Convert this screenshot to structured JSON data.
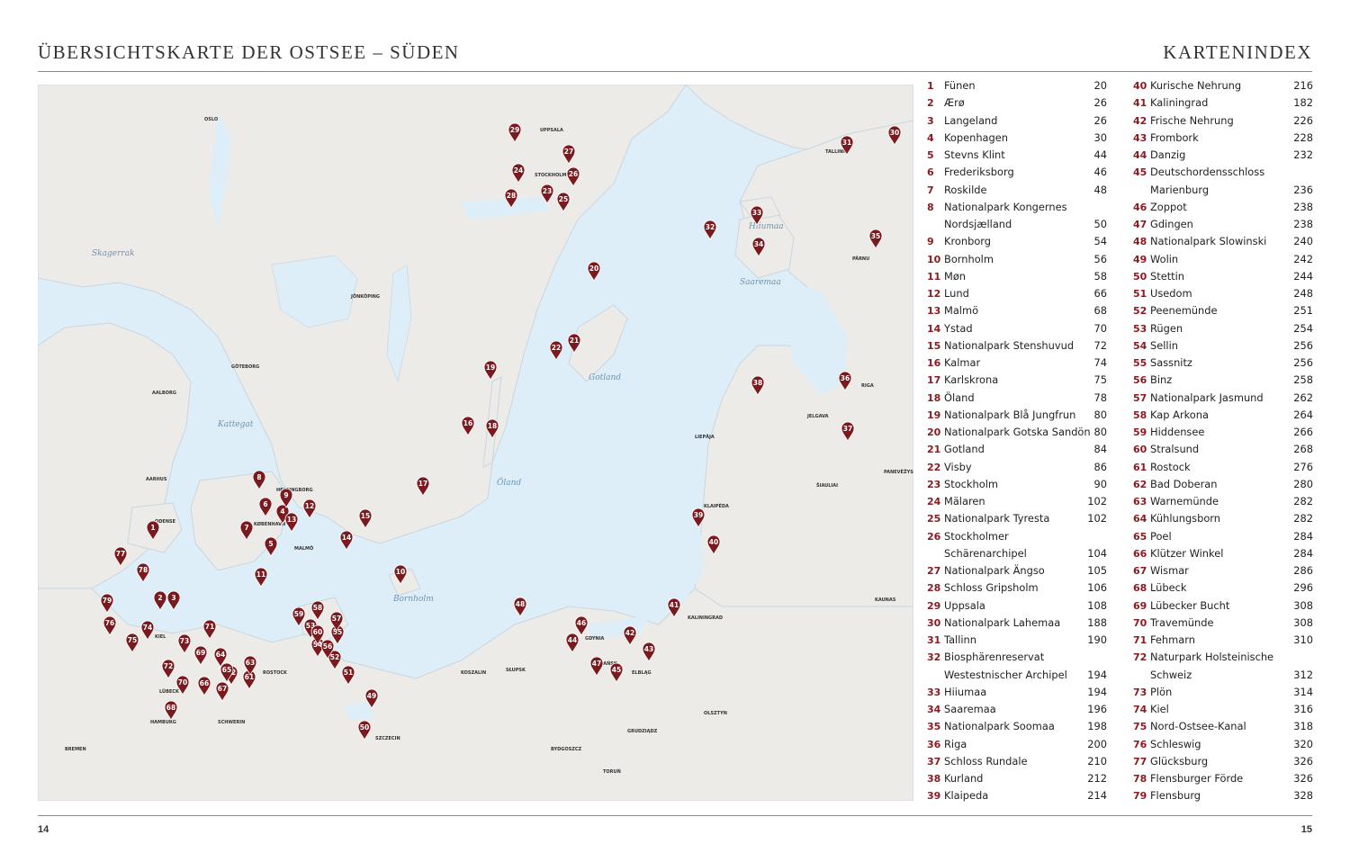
{
  "header": {
    "left_title": "ÜBERSICHTSKARTE DER OSTSEE – SÜDEN",
    "right_title": "KARTENINDEX"
  },
  "footer": {
    "left_page": "14",
    "right_page": "15"
  },
  "colors": {
    "pin": "#7a1a1f",
    "sea": "#ddeef8",
    "land": "#ececea",
    "index_number": "#8a1c22"
  },
  "map": {
    "city_labels": [
      "OSLO",
      "UPPSALA",
      "STOCKHOLM",
      "TALLINN",
      "GÖTEBORG",
      "JÖNKÖPING",
      "AALBORG",
      "AARHUS",
      "HELSINGBORG",
      "KØBENHAVN",
      "MALMÖ",
      "ODENSE",
      "KIEL",
      "LÜBECK",
      "HAMBURG",
      "BREMEN",
      "SCHWERIN",
      "ROSTOCK",
      "SZCZECIN",
      "KOSZALIN",
      "SŁUPSK",
      "GDYNIA",
      "GDAŃSK",
      "ELBLĄG",
      "KALININGRAD",
      "KLAIPĖDA",
      "RIGA",
      "ŠIAULIAI",
      "PANEVĖŽYS",
      "KAUNAS",
      "BYDGOSZCZ",
      "TORUŃ",
      "OLSZTYN",
      "GRUDZIĄDZ",
      "PÄRNU",
      "LIEPĀJA",
      "JELGAVA"
    ],
    "sea_labels": [
      "Kattegat",
      "Skagerrak",
      "Gotland",
      "Öland",
      "Saaremaa",
      "Hiiumaa",
      "Bornholm"
    ],
    "markers": [
      "1",
      "2",
      "3",
      "4",
      "5",
      "6",
      "7",
      "8",
      "9",
      "10",
      "11",
      "12",
      "13",
      "14",
      "15",
      "16",
      "17",
      "18",
      "19",
      "20",
      "21",
      "22",
      "23",
      "24",
      "25",
      "26",
      "27",
      "28",
      "29",
      "30",
      "31",
      "32",
      "33",
      "34",
      "35",
      "36",
      "37",
      "38",
      "39",
      "40",
      "41",
      "42",
      "43",
      "44",
      "45",
      "46",
      "47",
      "48",
      "49",
      "50",
      "51",
      "52",
      "53",
      "54",
      "55",
      "56",
      "57",
      "58",
      "59",
      "60",
      "61",
      "62",
      "63",
      "64",
      "65",
      "66",
      "67",
      "68",
      "69",
      "70",
      "71",
      "72",
      "73",
      "74",
      "75",
      "76",
      "77",
      "78",
      "79"
    ]
  },
  "index": {
    "col1": [
      {
        "num": "1",
        "name": "Fünen",
        "page": "20"
      },
      {
        "num": "2",
        "name": "Ærø",
        "page": "26"
      },
      {
        "num": "3",
        "name": "Langeland",
        "page": "26"
      },
      {
        "num": "4",
        "name": "Kopenhagen",
        "page": "30"
      },
      {
        "num": "5",
        "name": "Stevns Klint",
        "page": "44"
      },
      {
        "num": "6",
        "name": "Frederiksborg",
        "page": "46"
      },
      {
        "num": "7",
        "name": "Roskilde",
        "page": "48"
      },
      {
        "num": "8",
        "name": "Nationalpark Kongernes",
        "page": ""
      },
      {
        "num": "",
        "name": "Nordsjælland",
        "page": "50"
      },
      {
        "num": "9",
        "name": "Kronborg",
        "page": "54"
      },
      {
        "num": "10",
        "name": "Bornholm",
        "page": "56"
      },
      {
        "num": "11",
        "name": "Møn",
        "page": "58"
      },
      {
        "num": "12",
        "name": "Lund",
        "page": "66"
      },
      {
        "num": "13",
        "name": "Malmö",
        "page": "68"
      },
      {
        "num": "14",
        "name": "Ystad",
        "page": "70"
      },
      {
        "num": "15",
        "name": "Nationalpark Stenshuvud",
        "page": "72"
      },
      {
        "num": "16",
        "name": "Kalmar",
        "page": "74"
      },
      {
        "num": "17",
        "name": "Karlskrona",
        "page": "75"
      },
      {
        "num": "18",
        "name": "Öland",
        "page": "78"
      },
      {
        "num": "19",
        "name": "Nationalpark Blå Jungfrun",
        "page": "80"
      },
      {
        "num": "20",
        "name": "Nationalpark Gotska Sandön",
        "page": "80"
      },
      {
        "num": "21",
        "name": "Gotland",
        "page": "84"
      },
      {
        "num": "22",
        "name": "Visby",
        "page": "86"
      },
      {
        "num": "23",
        "name": "Stockholm",
        "page": "90"
      },
      {
        "num": "24",
        "name": "Mälaren",
        "page": "102"
      },
      {
        "num": "25",
        "name": "Nationalpark Tyresta",
        "page": "102"
      },
      {
        "num": "26",
        "name": "Stockholmer",
        "page": ""
      },
      {
        "num": "",
        "name": "Schärenarchipel",
        "page": "104"
      },
      {
        "num": "27",
        "name": "Nationalpark Ängso",
        "page": "105"
      },
      {
        "num": "28",
        "name": "Schloss Gripsholm",
        "page": "106"
      },
      {
        "num": "29",
        "name": "Uppsala",
        "page": "108"
      },
      {
        "num": "30",
        "name": "Nationalpark Lahemaa",
        "page": "188"
      },
      {
        "num": "31",
        "name": "Tallinn",
        "page": "190"
      },
      {
        "num": "32",
        "name": "Biosphärenreservat",
        "page": ""
      },
      {
        "num": "",
        "name": "Westestnischer Archipel",
        "page": "194"
      },
      {
        "num": "33",
        "name": "Hiiumaa",
        "page": "194"
      },
      {
        "num": "34",
        "name": "Saaremaa",
        "page": "196"
      },
      {
        "num": "35",
        "name": "Nationalpark Soomaa",
        "page": "198"
      },
      {
        "num": "36",
        "name": "Riga",
        "page": "200"
      },
      {
        "num": "37",
        "name": "Schloss Rundale",
        "page": "210"
      },
      {
        "num": "38",
        "name": "Kurland",
        "page": "212"
      },
      {
        "num": "39",
        "name": "Klaipeda",
        "page": "214"
      }
    ],
    "col2": [
      {
        "num": "40",
        "name": "Kurische Nehrung",
        "page": "216"
      },
      {
        "num": "41",
        "name": "Kaliningrad",
        "page": "182"
      },
      {
        "num": "42",
        "name": "Frische Nehrung",
        "page": "226"
      },
      {
        "num": "43",
        "name": "Frombork",
        "page": "228"
      },
      {
        "num": "44",
        "name": "Danzig",
        "page": "232"
      },
      {
        "num": "45",
        "name": "Deutschordensschloss",
        "page": ""
      },
      {
        "num": "",
        "name": "Marienburg",
        "page": "236"
      },
      {
        "num": "46",
        "name": "Zoppot",
        "page": "238"
      },
      {
        "num": "47",
        "name": "Gdingen",
        "page": "238"
      },
      {
        "num": "48",
        "name": "Nationalpark Slowinski",
        "page": "240"
      },
      {
        "num": "49",
        "name": "Wolin",
        "page": "242"
      },
      {
        "num": "50",
        "name": "Stettin",
        "page": "244"
      },
      {
        "num": "51",
        "name": "Usedom",
        "page": "248"
      },
      {
        "num": "52",
        "name": "Peenemünde",
        "page": "251"
      },
      {
        "num": "53",
        "name": "Rügen",
        "page": "254"
      },
      {
        "num": "54",
        "name": "Sellin",
        "page": "256"
      },
      {
        "num": "55",
        "name": "Sassnitz",
        "page": "256"
      },
      {
        "num": "56",
        "name": "Binz",
        "page": "258"
      },
      {
        "num": "57",
        "name": "Nationalpark Jasmund",
        "page": "262"
      },
      {
        "num": "58",
        "name": "Kap Arkona",
        "page": "264"
      },
      {
        "num": "59",
        "name": "Hiddensee",
        "page": "266"
      },
      {
        "num": "60",
        "name": "Stralsund",
        "page": "268"
      },
      {
        "num": "61",
        "name": "Rostock",
        "page": "276"
      },
      {
        "num": "62",
        "name": "Bad Doberan",
        "page": "280"
      },
      {
        "num": "63",
        "name": "Warnemünde",
        "page": "282"
      },
      {
        "num": "64",
        "name": "Kühlungsborn",
        "page": "282"
      },
      {
        "num": "65",
        "name": "Poel",
        "page": "284"
      },
      {
        "num": "66",
        "name": "Klützer Winkel",
        "page": "284"
      },
      {
        "num": "67",
        "name": "Wismar",
        "page": "286"
      },
      {
        "num": "68",
        "name": "Lübeck",
        "page": "296"
      },
      {
        "num": "69",
        "name": "Lübecker Bucht",
        "page": "308"
      },
      {
        "num": "70",
        "name": "Travemünde",
        "page": "308"
      },
      {
        "num": "71",
        "name": "Fehmarn",
        "page": "310"
      },
      {
        "num": "72",
        "name": "Naturpark Holsteinische",
        "page": ""
      },
      {
        "num": "",
        "name": "Schweiz",
        "page": "312"
      },
      {
        "num": "73",
        "name": "Plön",
        "page": "314"
      },
      {
        "num": "74",
        "name": "Kiel",
        "page": "316"
      },
      {
        "num": "75",
        "name": "Nord-Ostsee-Kanal",
        "page": "318"
      },
      {
        "num": "76",
        "name": "Schleswig",
        "page": "320"
      },
      {
        "num": "77",
        "name": "Glücksburg",
        "page": "326"
      },
      {
        "num": "78",
        "name": "Flensburger Förde",
        "page": "326"
      },
      {
        "num": "79",
        "name": "Flensburg",
        "page": "328"
      }
    ]
  }
}
